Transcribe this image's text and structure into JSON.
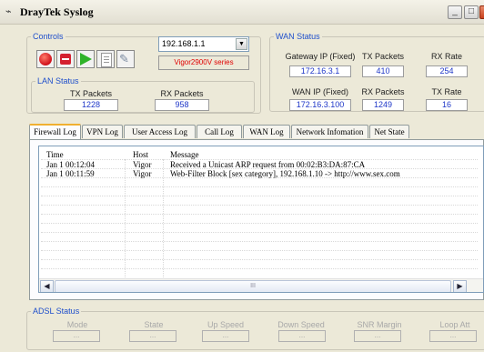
{
  "window": {
    "title": "DrayTek Syslog"
  },
  "controls": {
    "legend": "Controls",
    "ip_value": "192.168.1.1",
    "model": "Vigor2900V series"
  },
  "lan": {
    "legend": "LAN Status",
    "tx_label": "TX Packets",
    "rx_label": "RX Packets",
    "tx_value": "1228",
    "rx_value": "958"
  },
  "wan": {
    "legend": "WAN Status",
    "gateway_label": "Gateway IP (Fixed)",
    "tx_label": "TX Packets",
    "rx_rate_label": "RX Rate",
    "gateway_value": "172.16.3.1",
    "tx_value": "410",
    "rx_rate_value": "254",
    "wan_ip_label": "WAN IP (Fixed)",
    "rx_packets_label": "RX Packets",
    "tx_rate_label": "TX Rate",
    "wan_ip_value": "172.16.3.100",
    "rx_packets_value": "1249",
    "tx_rate_value": "16"
  },
  "tabs": [
    "Firewall Log",
    "VPN Log",
    "User Access Log",
    "Call Log",
    "WAN Log",
    "Network Infomation",
    "Net State"
  ],
  "log": {
    "headers": {
      "time": "Time",
      "host": "Host",
      "message": "Message"
    },
    "rows": [
      {
        "time": "Jan  1 00:12:04",
        "host": "Vigor",
        "message": "Received a Unicast ARP request from 00:02:B3:DA:87:CA"
      },
      {
        "time": "Jan  1 00:11:59",
        "host": "Vigor",
        "message": "Web-Filter Block [sex category], 192.168.1.10 -> http://www.sex.com"
      }
    ],
    "scroll_thumb": "III"
  },
  "adsl": {
    "legend": "ADSL Status",
    "labels": [
      "Mode",
      "State",
      "Up Speed",
      "Down Speed",
      "SNR Margin",
      "Loop Att"
    ],
    "values": [
      "...",
      "...",
      "...",
      "...",
      "...",
      "..."
    ]
  }
}
